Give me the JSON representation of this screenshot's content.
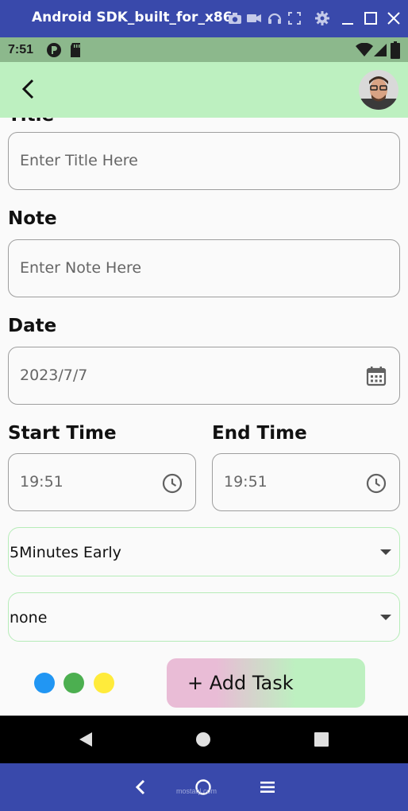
{
  "emulator": {
    "title": "Android SDK_built_for_x86",
    "bottom_watermark": "mostaql.com"
  },
  "status_bar": {
    "time": "7:51"
  },
  "form": {
    "title_field": {
      "placeholder": "Enter Title Here"
    },
    "note_label": "Note",
    "note_field": {
      "placeholder": "Enter Note Here"
    },
    "date_label": "Date",
    "date_field": {
      "value": "2023/7/7"
    },
    "start_time_label": "Start Time",
    "start_time_field": {
      "value": "19:51"
    },
    "end_time_label": "End Time",
    "end_time_field": {
      "value": "19:51"
    },
    "remind_select": {
      "value": "5Minutes Early"
    },
    "repeat_select": {
      "value": "none"
    },
    "colors": [
      "#2196f3",
      "#4caf50",
      "#ffeb3b"
    ],
    "add_task_label": "+ Add Task"
  },
  "colors": {
    "appbar": "#bdf0c0",
    "emulator_chrome": "#3949ab",
    "statusbar": "#8cb88c"
  }
}
